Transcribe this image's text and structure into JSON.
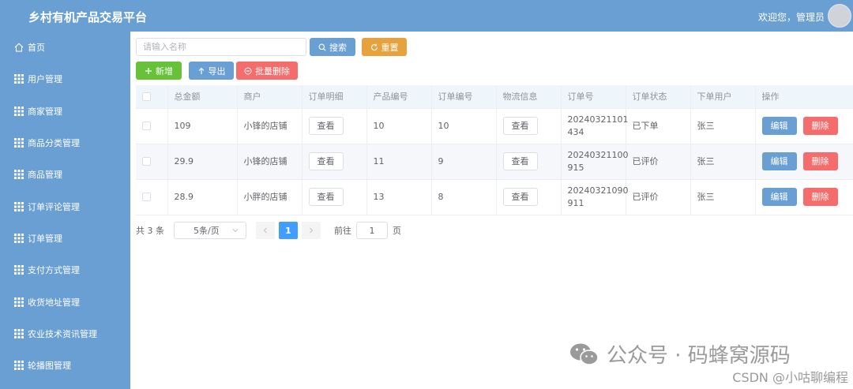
{
  "header": {
    "title": "乡村有机产品交易平台",
    "welcome": "欢迎您，管理员"
  },
  "sidebar": {
    "items": [
      {
        "label": "首页",
        "icon": "home-icon"
      },
      {
        "label": "用户管理",
        "icon": "grid-icon"
      },
      {
        "label": "商家管理",
        "icon": "grid-icon"
      },
      {
        "label": "商品分类管理",
        "icon": "grid-icon"
      },
      {
        "label": "商品管理",
        "icon": "grid-icon"
      },
      {
        "label": "订单评论管理",
        "icon": "grid-icon"
      },
      {
        "label": "订单管理",
        "icon": "grid-icon"
      },
      {
        "label": "支付方式管理",
        "icon": "grid-icon"
      },
      {
        "label": "收货地址管理",
        "icon": "grid-icon"
      },
      {
        "label": "农业技术资讯管理",
        "icon": "grid-icon"
      },
      {
        "label": "轮播图管理",
        "icon": "grid-icon"
      }
    ]
  },
  "toolbar": {
    "search_placeholder": "请输入名称",
    "search_label": "搜索",
    "reset_label": "重置",
    "add_label": "新增",
    "export_label": "导出",
    "batch_delete_label": "批量删除"
  },
  "table": {
    "headers": [
      "总金额",
      "商户",
      "订单明细",
      "产品编号",
      "订单编号",
      "物流信息",
      "订单号",
      "订单状态",
      "下单用户",
      "操作"
    ],
    "view_label": "查看",
    "edit_label": "编辑",
    "delete_label": "删除",
    "rows": [
      {
        "amount": "109",
        "merchant": "小锋的店铺",
        "product_no": "10",
        "order_id": "10",
        "order_no_1": "20240321101",
        "order_no_2": "434",
        "status": "已下单",
        "user": "张三"
      },
      {
        "amount": "29.9",
        "merchant": "小锋的店铺",
        "product_no": "11",
        "order_id": "9",
        "order_no_1": "20240321100",
        "order_no_2": "915",
        "status": "已评价",
        "user": "张三"
      },
      {
        "amount": "28.9",
        "merchant": "小胖的店铺",
        "product_no": "13",
        "order_id": "8",
        "order_no_1": "20240321090",
        "order_no_2": "911",
        "status": "已评价",
        "user": "张三"
      }
    ]
  },
  "pagination": {
    "total": "共 3 条",
    "page_size": "5条/页",
    "current_page": "1",
    "goto_label": "前往",
    "goto_value": "1",
    "page_suffix": "页"
  },
  "watermark": {
    "text": "公众号 · 码蜂窝源码",
    "csdn": "CSDN @小咕聊编程"
  }
}
